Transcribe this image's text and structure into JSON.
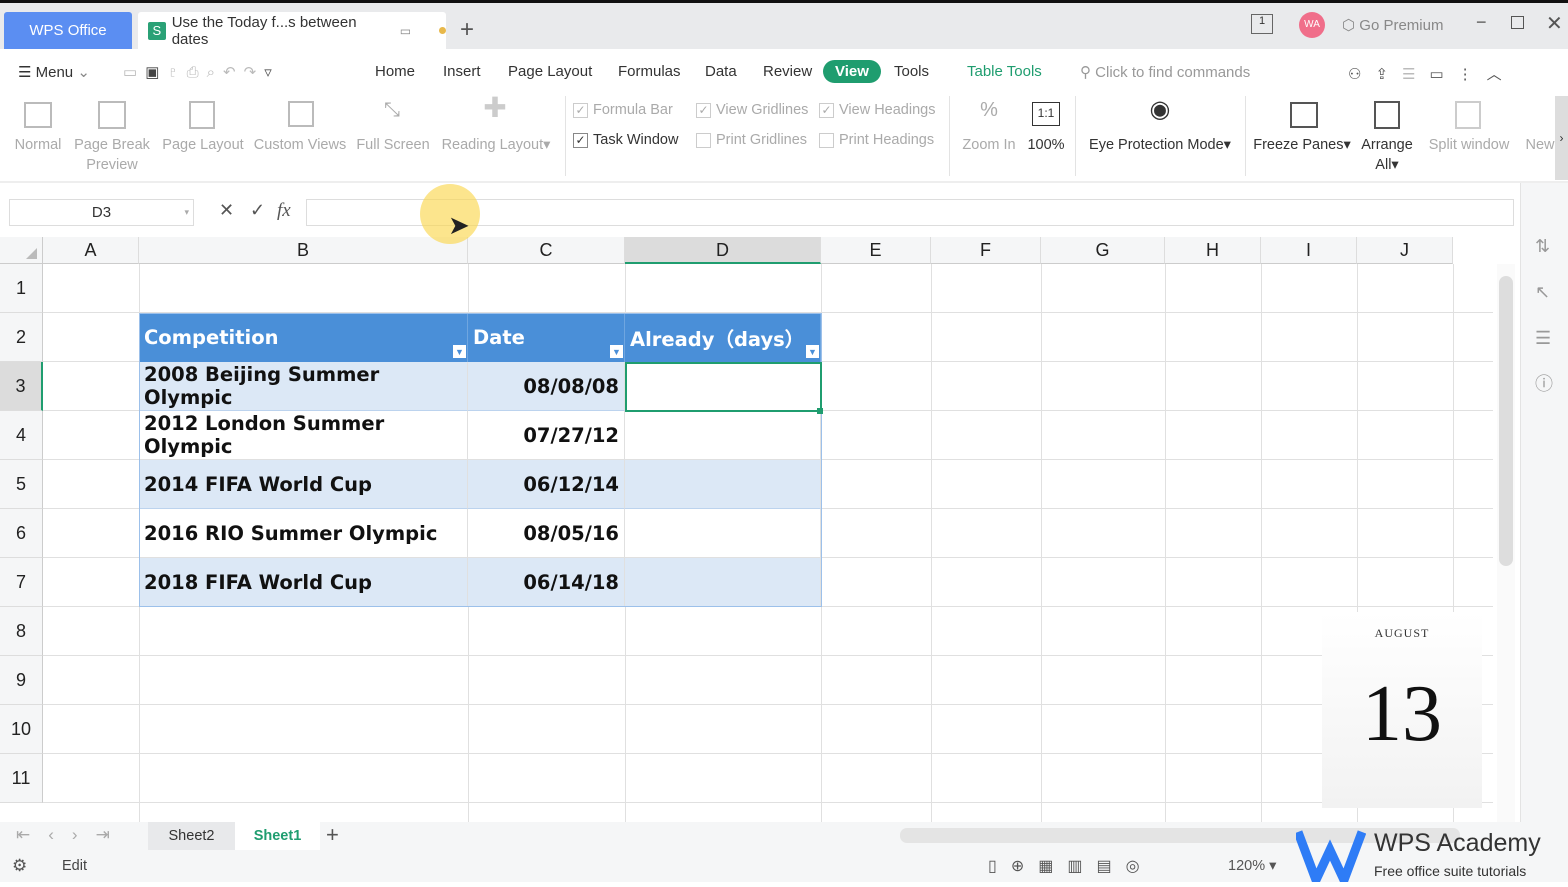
{
  "titlebar": {
    "app_tab": "WPS Office",
    "doc_tab": "Use the Today f...s between dates",
    "doc_icon": "S",
    "go_premium": "Go Premium",
    "avatar": "WA"
  },
  "menu": {
    "menu_label": "Menu",
    "tabs": [
      "Home",
      "Insert",
      "Page Layout",
      "Formulas",
      "Data",
      "Review",
      "View",
      "Tools"
    ],
    "active_tab": "View",
    "table_tools": "Table Tools",
    "search_placeholder": "Click to find commands"
  },
  "ribbon": {
    "normal": "Normal",
    "page_break_1": "Page Break",
    "page_break_2": "Preview",
    "page_layout": "Page Layout",
    "custom_views": "Custom Views",
    "full_screen": "Full Screen",
    "reading_layout": "Reading Layout",
    "formula_bar": "Formula Bar",
    "task_window": "Task Window",
    "view_gridlines": "View Gridlines",
    "print_gridlines": "Print Gridlines",
    "view_headings": "View Headings",
    "print_headings": "Print Headings",
    "zoom_in": "Zoom In",
    "zoom_100": "100%",
    "zoom_100_icon": "1:1",
    "eye_protection": "Eye Protection Mode",
    "freeze_panes": "Freeze Panes",
    "arrange_1": "Arrange",
    "arrange_2": "All",
    "split_window": "Split window",
    "new": "New",
    "checks": {
      "formula_bar": true,
      "task_window": true,
      "view_gridlines": true,
      "print_gridlines": false,
      "view_headings": true,
      "print_headings": false
    }
  },
  "formula_bar": {
    "name_box": "D3",
    "fx": "fx",
    "value": ""
  },
  "columns": [
    "A",
    "B",
    "C",
    "D",
    "E",
    "F",
    "G",
    "H",
    "I",
    "J"
  ],
  "rows": [
    "1",
    "2",
    "3",
    "4",
    "5",
    "6",
    "7",
    "8",
    "9",
    "10",
    "11"
  ],
  "table": {
    "headers": [
      "Competition",
      "Date",
      "Already（days）"
    ],
    "rows": [
      [
        "2008 Beijing Summer Olympic",
        "08/08/08",
        ""
      ],
      [
        "2012 London Summer Olympic",
        "07/27/12",
        ""
      ],
      [
        "2014 FIFA World Cup",
        "06/12/14",
        ""
      ],
      [
        "2016 RIO Summer Olympic",
        "08/05/16",
        ""
      ],
      [
        "2018 FIFA World Cup",
        "06/14/18",
        ""
      ]
    ]
  },
  "calendar": {
    "month": "AUGUST",
    "day": "13"
  },
  "sheets": {
    "tabs": [
      "Sheet2",
      "Sheet1"
    ],
    "active": "Sheet1"
  },
  "status": {
    "mode": "Edit",
    "zoom": "120%"
  },
  "watermark": {
    "title": "WPS Academy",
    "subtitle": "Free office suite tutorials"
  },
  "colors": {
    "accent": "#1f9d6f",
    "header_blue": "#4a8fd8",
    "band": "#dce8f6",
    "wps_tab": "#5b8ef2"
  }
}
